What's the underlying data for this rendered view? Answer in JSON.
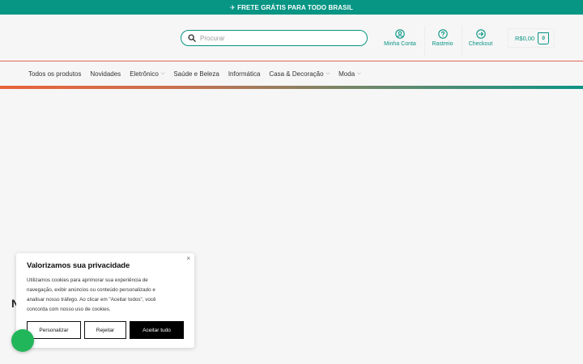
{
  "promo": {
    "text": "✈ FRETE GRÁTIS PARA TODO BRASIL"
  },
  "search": {
    "placeholder": "Procurar"
  },
  "header_links": {
    "account": "Minha Conta",
    "tracking": "Rastreio",
    "checkout": "Checkout"
  },
  "cart": {
    "total": "R$0,00",
    "count": "0"
  },
  "nav": {
    "items": [
      {
        "label": "Todos os produtos"
      },
      {
        "label": "Novidades"
      },
      {
        "label": "Eletrônico"
      },
      {
        "label": "Saúde e Beleza"
      },
      {
        "label": "Informática"
      },
      {
        "label": "Casa & Decoração"
      },
      {
        "label": "Moda"
      }
    ]
  },
  "partial": {
    "heading_fragment": "N"
  },
  "cookie": {
    "title": "Valorizamos sua privacidade",
    "body": "Utilizamos cookies para aprimorar sua experiência de navegação, exibir anúncios ou conteúdo personalizado e analisar nosso tráfego. Ao clicar em \"Aceitar todos\", você concorda com nosso uso de cookies.",
    "customize_label": "Personalizar",
    "reject_label": "Rejeitar",
    "accept_label": "Aceitar tudo",
    "close_glyph": "×"
  },
  "colors": {
    "brand": "#079584",
    "accent_line": "#e06a55",
    "whatsapp": "#22b65a"
  },
  "icons": {
    "search": "search-icon",
    "account": "user-circle-icon",
    "tracking": "help-circle-icon",
    "checkout": "arrow-right-circle-icon",
    "cart": "shopping-bag-icon",
    "dropdown": "chevron-down-icon",
    "whatsapp": "whatsapp-icon"
  }
}
